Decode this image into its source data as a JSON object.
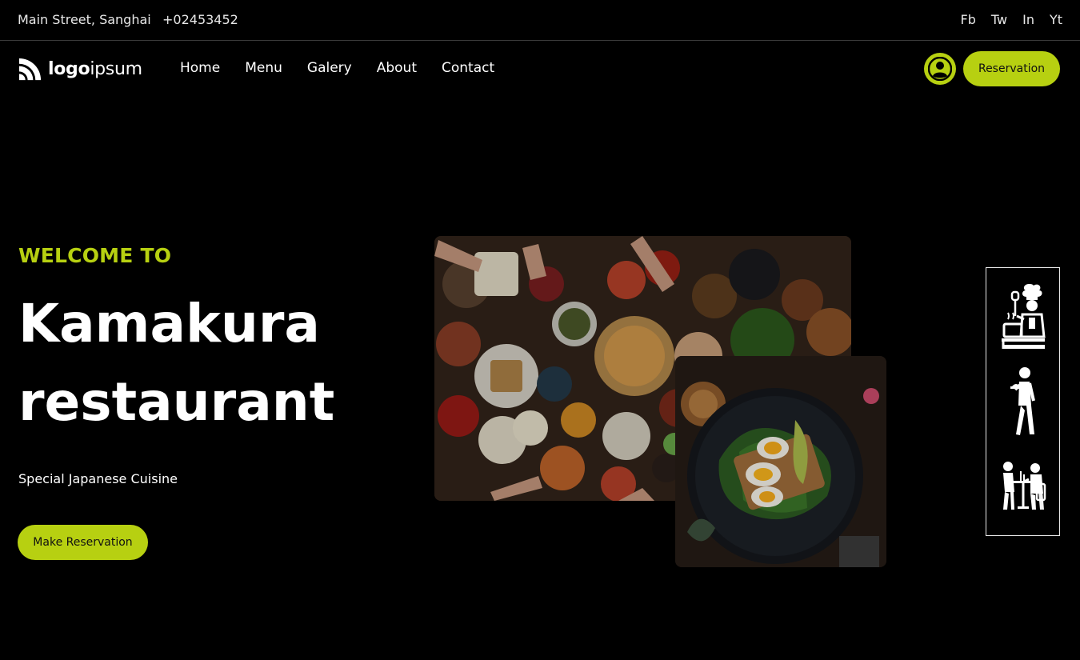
{
  "topbar": {
    "address": "Main Street, Sanghai",
    "phone": "+02453452",
    "socials": [
      "Fb",
      "Tw",
      "In",
      "Yt"
    ]
  },
  "logo": {
    "bold": "logo",
    "light": "ipsum"
  },
  "nav": {
    "items": [
      "Home",
      "Menu",
      "Galery",
      "About",
      "Contact"
    ]
  },
  "header": {
    "reservation_label": "Reservation"
  },
  "hero": {
    "eyebrow": "WELCOME TO",
    "title_line1": "Kamakura",
    "title_line2": "restaurant",
    "subtitle": "Special Japanese Cuisine",
    "cta_label": "Make Reservation"
  },
  "images": {
    "main": "food-table-photo",
    "secondary": "egg-spinach-toast-photo"
  },
  "side_icons": [
    "chef-icon",
    "waiter-icon",
    "dining-couple-icon"
  ],
  "colors": {
    "accent": "#b7d011",
    "background": "#000000",
    "text": "#ffffff"
  }
}
